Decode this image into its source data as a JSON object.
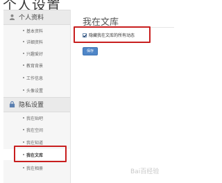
{
  "header": {
    "title": "个人设置"
  },
  "sidebar": {
    "group_profile": {
      "label": "个人资料",
      "items": [
        {
          "label": "基本资料"
        },
        {
          "label": "详细资料"
        },
        {
          "label": "兴趣爱好"
        },
        {
          "label": "教育背景"
        },
        {
          "label": "工作信息"
        },
        {
          "label": "头像设置"
        }
      ]
    },
    "group_privacy": {
      "label": "隐私设置",
      "items": [
        {
          "label": "我在贴吧"
        },
        {
          "label": "我在空间"
        },
        {
          "label": "我在知道"
        },
        {
          "label": "我在文库",
          "active": true
        },
        {
          "label": "我在相册"
        }
      ]
    }
  },
  "main": {
    "title": "我在文库",
    "checkbox": {
      "label": "隐藏我在文库的所有动态",
      "checked": true
    },
    "save_label": "保存"
  },
  "watermark": "Bai百经验",
  "colors": {
    "accent": "#4f86c8",
    "highlight": "#c81e1e"
  },
  "icons": {
    "profile": "user-icon",
    "privacy": "lock-icon",
    "checkbox": "checkmark-icon"
  }
}
